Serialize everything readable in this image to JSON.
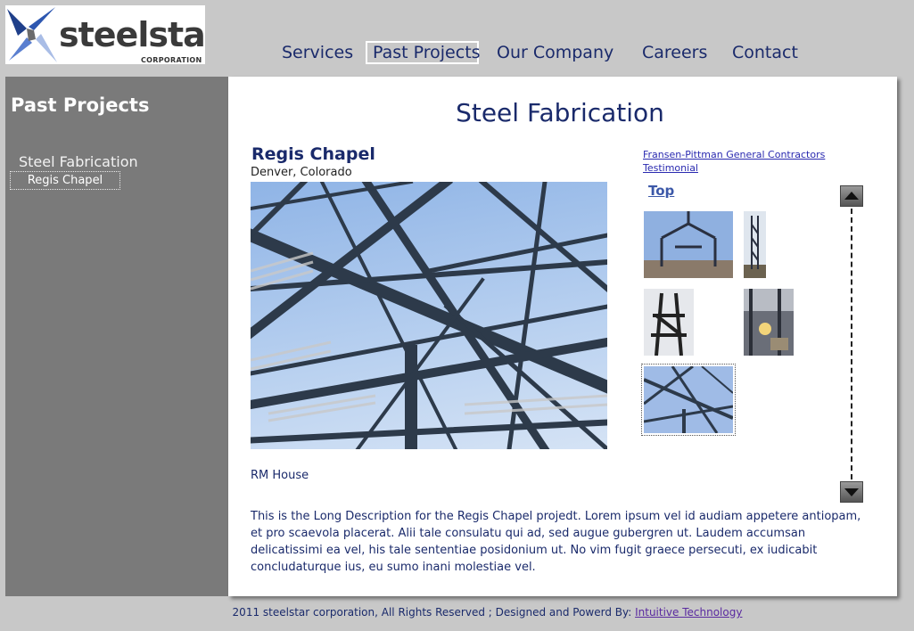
{
  "logo": {
    "wordmark": "steelstar",
    "subtitle": "CORPORATION"
  },
  "nav": {
    "items": [
      {
        "label": "Services"
      },
      {
        "label": "Past Projects",
        "active": true
      },
      {
        "label": "Our Company"
      },
      {
        "label": "Careers"
      },
      {
        "label": "Contact"
      }
    ]
  },
  "sidebar": {
    "title": "Past Projects",
    "section": "Steel Fabrication",
    "sub_item": "Regis Chapel"
  },
  "main": {
    "title": "Steel Fabrication",
    "project_title": "Regis Chapel",
    "project_location": "Denver, Colorado",
    "links": [
      "Fransen-Pittman General Contractors",
      "Testimonial"
    ],
    "top_link": "Top",
    "next_project": "RM House",
    "description": "This is the Long Description for the Regis Chapel projedt. Lorem ipsum vel id audiam appetere antiopam, et pro scaevola placerat. Alii tale consulatu qui ad, sed augue gubergren ut. Laudem accumsan delicatissimi ea vel, his tale sententiae posidonium ut. No vim fugit graece persecuti, ex iudicabit concludaturque ius, eu sumo inani molestiae vel."
  },
  "footer": {
    "text": "2011 steelstar corporation, All Rights Reserved ;   Designed and Powerd By: ",
    "link": "Intuitive Technology"
  },
  "colors": {
    "text": "#1a2a6b",
    "sidebar": "#7a7a7a",
    "background": "#c8c8c8",
    "link": "#2a2ab0"
  }
}
